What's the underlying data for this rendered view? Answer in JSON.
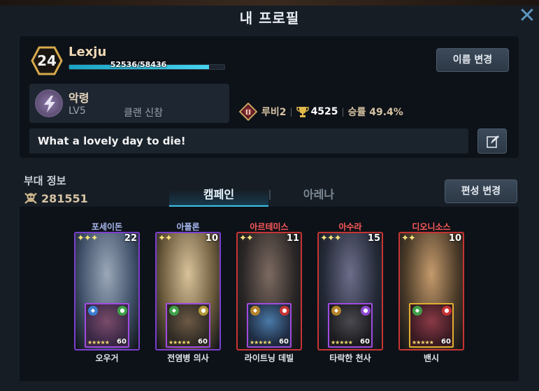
{
  "window": {
    "title": "내 프로필",
    "close_icon": "close-x-icon"
  },
  "profile": {
    "level": "24",
    "name": "Lexju",
    "xp_text": "52536/58436",
    "xp_fraction": 0.899,
    "rename_label": "이름 변경",
    "clan": {
      "icon": "lightning-emblem-icon",
      "name": "악령",
      "level": "LV5",
      "role": "클랜 신참"
    },
    "rank": {
      "emblem": "rank-ii-emblem-icon",
      "label": "루비2",
      "trophies": "4525",
      "winrate_label": "승률 49.4%"
    },
    "motto": "What a lovely day to die!",
    "edit_icon": "edit-pencil-icon"
  },
  "troop": {
    "title": "부대 정보",
    "power_icon": "skull-crossbones-icon",
    "power": "281551",
    "tabs": [
      "캠페인",
      "아레나"
    ],
    "active_tab": "캠페인",
    "formation_label": "편성 변경"
  },
  "heroes": [
    {
      "name": "포세이돈",
      "name_color": "#a9b8f0",
      "frame": "#7b3fd0",
      "stars": "✦✦✦",
      "level": "22",
      "portrait_a": "#41516a",
      "portrait_b": "#9aa8b8",
      "sub": {
        "name": "오우거",
        "frame": "#a04be0",
        "bg_a": "#3a2746",
        "bg_b": "#7a4c6a",
        "stars": "★★★★★",
        "level": "60",
        "badge1": "#3d7fd0",
        "badge2": "#3fa14a"
      }
    },
    {
      "name": "아폴론",
      "name_color": "#a9b8f0",
      "frame": "#7b3fd0",
      "stars": "✦✦",
      "level": "10",
      "portrait_a": "#6b5a3c",
      "portrait_b": "#d8c29a",
      "sub": {
        "name": "전염병 의사",
        "frame": "#a04be0",
        "bg_a": "#2f2a24",
        "bg_b": "#6c5a44",
        "stars": "★★★★★",
        "level": "60",
        "badge1": "#3fa14a",
        "badge2": "#b49a3a"
      }
    },
    {
      "name": "아르테미스",
      "name_color": "#ff5a5a",
      "frame": "#c83434",
      "stars": "✦✦",
      "level": "11",
      "portrait_a": "#2a2626",
      "portrait_b": "#7c6a60",
      "sub": {
        "name": "라이트닝 데빌",
        "frame": "#a04be0",
        "bg_a": "#1e2a40",
        "bg_b": "#4a7aa8",
        "stars": "★★★★★",
        "level": "60",
        "badge1": "#b4832a",
        "badge2": "#c83434"
      }
    },
    {
      "name": "아수라",
      "name_color": "#ff5a5a",
      "frame": "#c83434",
      "stars": "✦✦✦",
      "level": "15",
      "portrait_a": "#252a38",
      "portrait_b": "#6c6e8a",
      "sub": {
        "name": "타락한 천사",
        "frame": "#a04be0",
        "bg_a": "#1c1c20",
        "bg_b": "#4a4a50",
        "stars": "★★★★★",
        "level": "60",
        "badge1": "#b4832a",
        "badge2": "#8d4bd0"
      }
    },
    {
      "name": "디오니소스",
      "name_color": "#ff5a5a",
      "frame": "#c83434",
      "stars": "✦✦",
      "level": "10",
      "portrait_a": "#4a3a28",
      "portrait_b": "#c49a6c",
      "sub": {
        "name": "밴시",
        "frame": "#e0b030",
        "bg_a": "#3a1a22",
        "bg_b": "#8a3a46",
        "stars": "★★★★★",
        "level": "60",
        "badge1": "#3fa14a",
        "badge2": "#c83434"
      }
    }
  ]
}
